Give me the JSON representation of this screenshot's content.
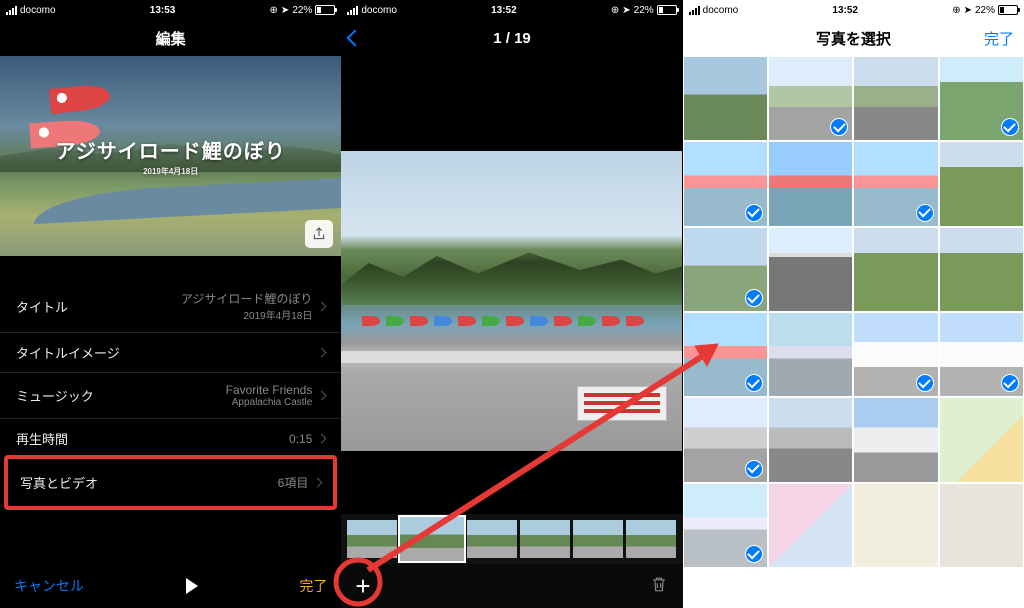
{
  "status": {
    "carrier": "docomo",
    "battery_pct": "22%",
    "loc_icon": "◀",
    "alarm_icon": "⏰"
  },
  "screen1": {
    "time": "13:53",
    "nav_title": "編集",
    "hero_title": "アジサイロード鯉のぼり",
    "hero_subtitle": "2019年4月18日",
    "rows": {
      "title": {
        "label": "タイトル",
        "value": "アジサイロード鯉のぼり",
        "sub": "2019年4月18日"
      },
      "title_image": {
        "label": "タイトルイメージ",
        "value": ""
      },
      "music": {
        "label": "ミュージック",
        "value": "Favorite Friends",
        "sub": "Appalachia Castle"
      },
      "duration": {
        "label": "再生時間",
        "value": "0:15"
      },
      "photos": {
        "label": "写真とビデオ",
        "value": "6項目"
      }
    },
    "toolbar": {
      "cancel": "キャンセル",
      "done": "完了"
    }
  },
  "screen2": {
    "time": "13:52",
    "counter": "1 / 19",
    "plus_label": "+"
  },
  "screen3": {
    "time": "13:52",
    "nav_title": "写真を選択",
    "done": "完了",
    "cells": [
      {
        "cls": "sky-green",
        "selected": false
      },
      {
        "cls": "sky-road",
        "selected": true
      },
      {
        "cls": "sky-road",
        "selected": false
      },
      {
        "cls": "green-hill",
        "selected": true
      },
      {
        "cls": "koin",
        "selected": true
      },
      {
        "cls": "koin",
        "selected": false
      },
      {
        "cls": "koin",
        "selected": true
      },
      {
        "cls": "field",
        "selected": false
      },
      {
        "cls": "sky-green",
        "selected": true
      },
      {
        "cls": "road",
        "selected": false
      },
      {
        "cls": "field",
        "selected": false
      },
      {
        "cls": "field",
        "selected": false
      },
      {
        "cls": "koin",
        "selected": true
      },
      {
        "cls": "town",
        "selected": false
      },
      {
        "cls": "bldg",
        "selected": true
      },
      {
        "cls": "bldg",
        "selected": true
      },
      {
        "cls": "parking",
        "selected": true
      },
      {
        "cls": "parking",
        "selected": false
      },
      {
        "cls": "bldg",
        "selected": false
      },
      {
        "cls": "poster-g",
        "selected": false
      },
      {
        "cls": "town",
        "selected": true
      },
      {
        "cls": "poster-p",
        "selected": false
      },
      {
        "cls": "poster-y",
        "selected": false
      },
      {
        "cls": "sign",
        "selected": false
      }
    ]
  },
  "colors": {
    "accent_blue": "#007aff",
    "accent_orange": "#ffb300",
    "anno_red": "#e53935"
  }
}
